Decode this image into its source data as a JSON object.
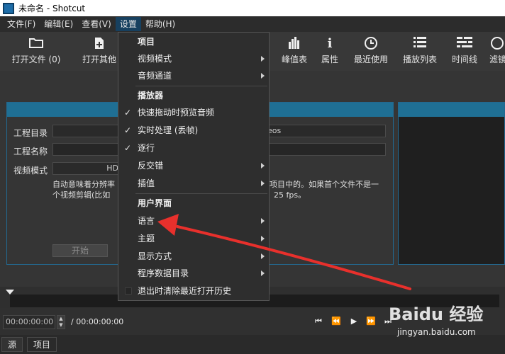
{
  "window": {
    "title": "未命名 - Shotcut"
  },
  "menubar": {
    "items": [
      {
        "label": "文件(F)"
      },
      {
        "label": "编辑(E)"
      },
      {
        "label": "查看(V)"
      },
      {
        "label": "设置"
      },
      {
        "label": "帮助(H)"
      }
    ]
  },
  "toolbar": {
    "open_file": "打开文件 (0)",
    "open_other": "打开其他",
    "peak_meter": "峰值表",
    "properties": "属性",
    "recent": "最近使用",
    "playlist": "播放列表",
    "timeline": "时间线",
    "filters": "滤镜"
  },
  "project": {
    "dir_label": "工程目录",
    "dir_value_suffix": "eos",
    "name_label": "工程名称",
    "mode_label": "视频模式",
    "mode_value": "HD",
    "desc_line1_left": "自动意味着分辨率",
    "desc_line1_right": "项目中的。如果首个文件不是一",
    "desc_line2_left": "个视频剪辑(比如",
    "desc_line2_right": "25 fps。",
    "start_button": "开始"
  },
  "settings_menu": {
    "project_header": "项目",
    "video_mode": "视频模式",
    "audio_channels": "音频通道",
    "player_header": "播放器",
    "scrub_audio": "快速拖动时预览音频",
    "realtime": "实时处理 (丢帧)",
    "progressive": "逐行",
    "deinterlace": "反交错",
    "interpolation": "插值",
    "ui_header": "用户界面",
    "language": "语言",
    "theme": "主题",
    "display_method": "显示方式",
    "app_data_dir": "程序数据目录",
    "clear_recent": "退出时清除最近打开历史",
    "check_mark": "✓"
  },
  "transport": {
    "timecode": "00:00:00:00",
    "duration": "/ 00:00:00:00"
  },
  "bottom_tabs": {
    "source": "源",
    "project": "项目"
  },
  "watermark": {
    "logo": "Baidu 经验",
    "url": "jingyan.baidu.com"
  },
  "colors": {
    "accent": "#1f6f94",
    "menu_highlight": "#17405f",
    "annotation_arrow": "#e8302c"
  }
}
